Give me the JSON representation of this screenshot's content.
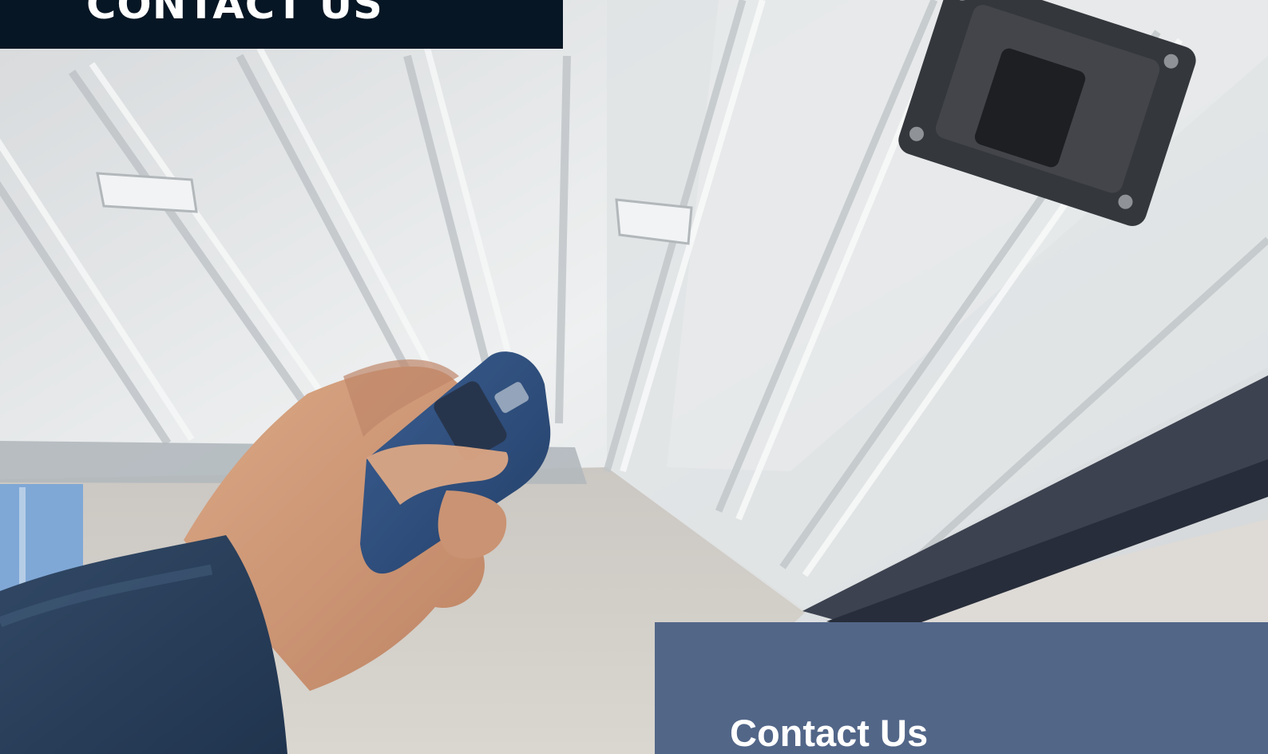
{
  "banner": {
    "title": "CONTACT US",
    "background_color": "#071624"
  },
  "hero": {
    "image_subject": "hand-pressing-garage-remote-image"
  },
  "contact_panel": {
    "heading": "Contact Us",
    "background_color": "#526688"
  }
}
